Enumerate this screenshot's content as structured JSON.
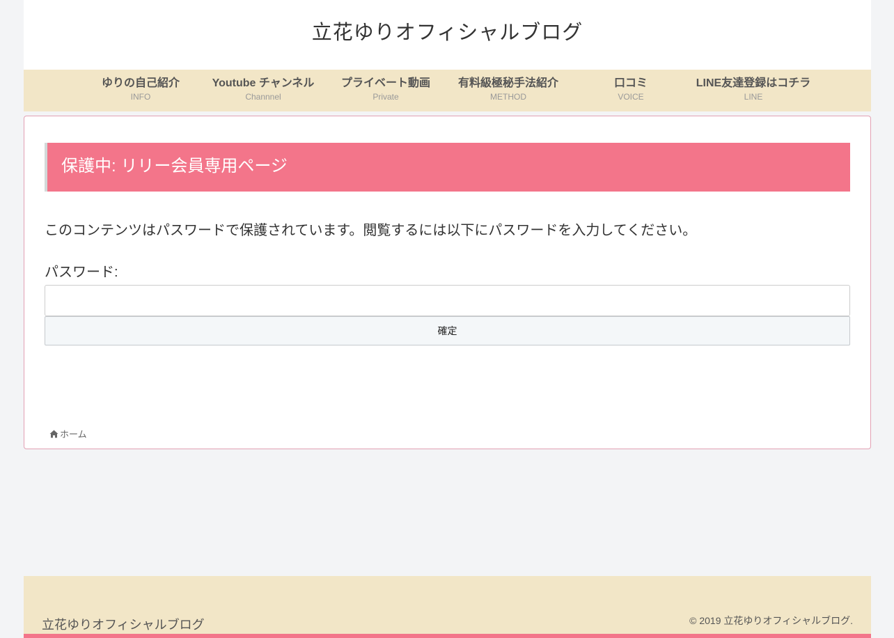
{
  "header": {
    "site_title": "立花ゆりオフィシャルブログ"
  },
  "nav": {
    "items": [
      {
        "label": "ゆりの自己紹介",
        "sub": "INFO"
      },
      {
        "label": "Youtube チャンネル",
        "sub": "Channnel"
      },
      {
        "label": "プライベート動画",
        "sub": "Private"
      },
      {
        "label": "有料級極秘手法紹介",
        "sub": "METHOD"
      },
      {
        "label": "口コミ",
        "sub": "VOICE"
      },
      {
        "label": "LINE友達登録はコチラ",
        "sub": "LINE"
      }
    ]
  },
  "main": {
    "title": "保護中: リリー会員専用ページ",
    "message": "このコンテンツはパスワードで保護されています。閲覧するには以下にパスワードを入力してください。",
    "password_label": "パスワード:",
    "password_value": "",
    "submit_label": "確定"
  },
  "breadcrumb": {
    "icon": "home-icon",
    "home_label": "ホーム"
  },
  "footer": {
    "site_title": "立花ゆりオフィシャルブログ",
    "copyright": "© 2019 立花ゆりオフィシャルブログ."
  },
  "colors": {
    "accent_pink": "#f3758a",
    "nav_beige": "#f2e6c7",
    "page_bg": "#f3f4f6"
  }
}
